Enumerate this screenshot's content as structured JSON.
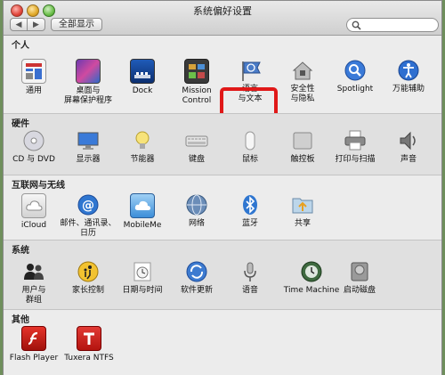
{
  "window": {
    "title": "系统偏好设置"
  },
  "toolbar": {
    "back_glyph": "◀",
    "forward_glyph": "▶",
    "show_all_label": "全部显示",
    "search_placeholder": "",
    "search_icon": "magnifier"
  },
  "sections": [
    {
      "label": "个人",
      "panes": [
        {
          "label": "通用"
        },
        {
          "label": "桌面与\n屏幕保护程序"
        },
        {
          "label": "Dock"
        },
        {
          "label": "Mission\nControl"
        },
        {
          "label": "语言\n与文本"
        },
        {
          "label": "安全性\n与隐私"
        },
        {
          "label": "Spotlight"
        },
        {
          "label": "万能辅助"
        }
      ]
    },
    {
      "label": "硬件",
      "panes": [
        {
          "label": "CD 与 DVD"
        },
        {
          "label": "显示器"
        },
        {
          "label": "节能器"
        },
        {
          "label": "键盘"
        },
        {
          "label": "鼠标"
        },
        {
          "label": "触控板"
        },
        {
          "label": "打印与扫描"
        },
        {
          "label": "声音"
        }
      ]
    },
    {
      "label": "互联网与无线",
      "panes": [
        {
          "label": "iCloud"
        },
        {
          "label": "邮件、通讯录、\n日历"
        },
        {
          "label": "MobileMe"
        },
        {
          "label": "网络"
        },
        {
          "label": "蓝牙"
        },
        {
          "label": "共享"
        }
      ]
    },
    {
      "label": "系统",
      "panes": [
        {
          "label": "用户与\n群组"
        },
        {
          "label": "家长控制"
        },
        {
          "label": "日期与时间"
        },
        {
          "label": "软件更新"
        },
        {
          "label": "语音"
        },
        {
          "label": "Time Machine"
        },
        {
          "label": "启动磁盘"
        }
      ]
    },
    {
      "label": "其他",
      "panes": [
        {
          "label": "Flash Player"
        },
        {
          "label": "Tuxera NTFS"
        }
      ]
    }
  ],
  "colors": {
    "highlight_border": "#e01818"
  }
}
